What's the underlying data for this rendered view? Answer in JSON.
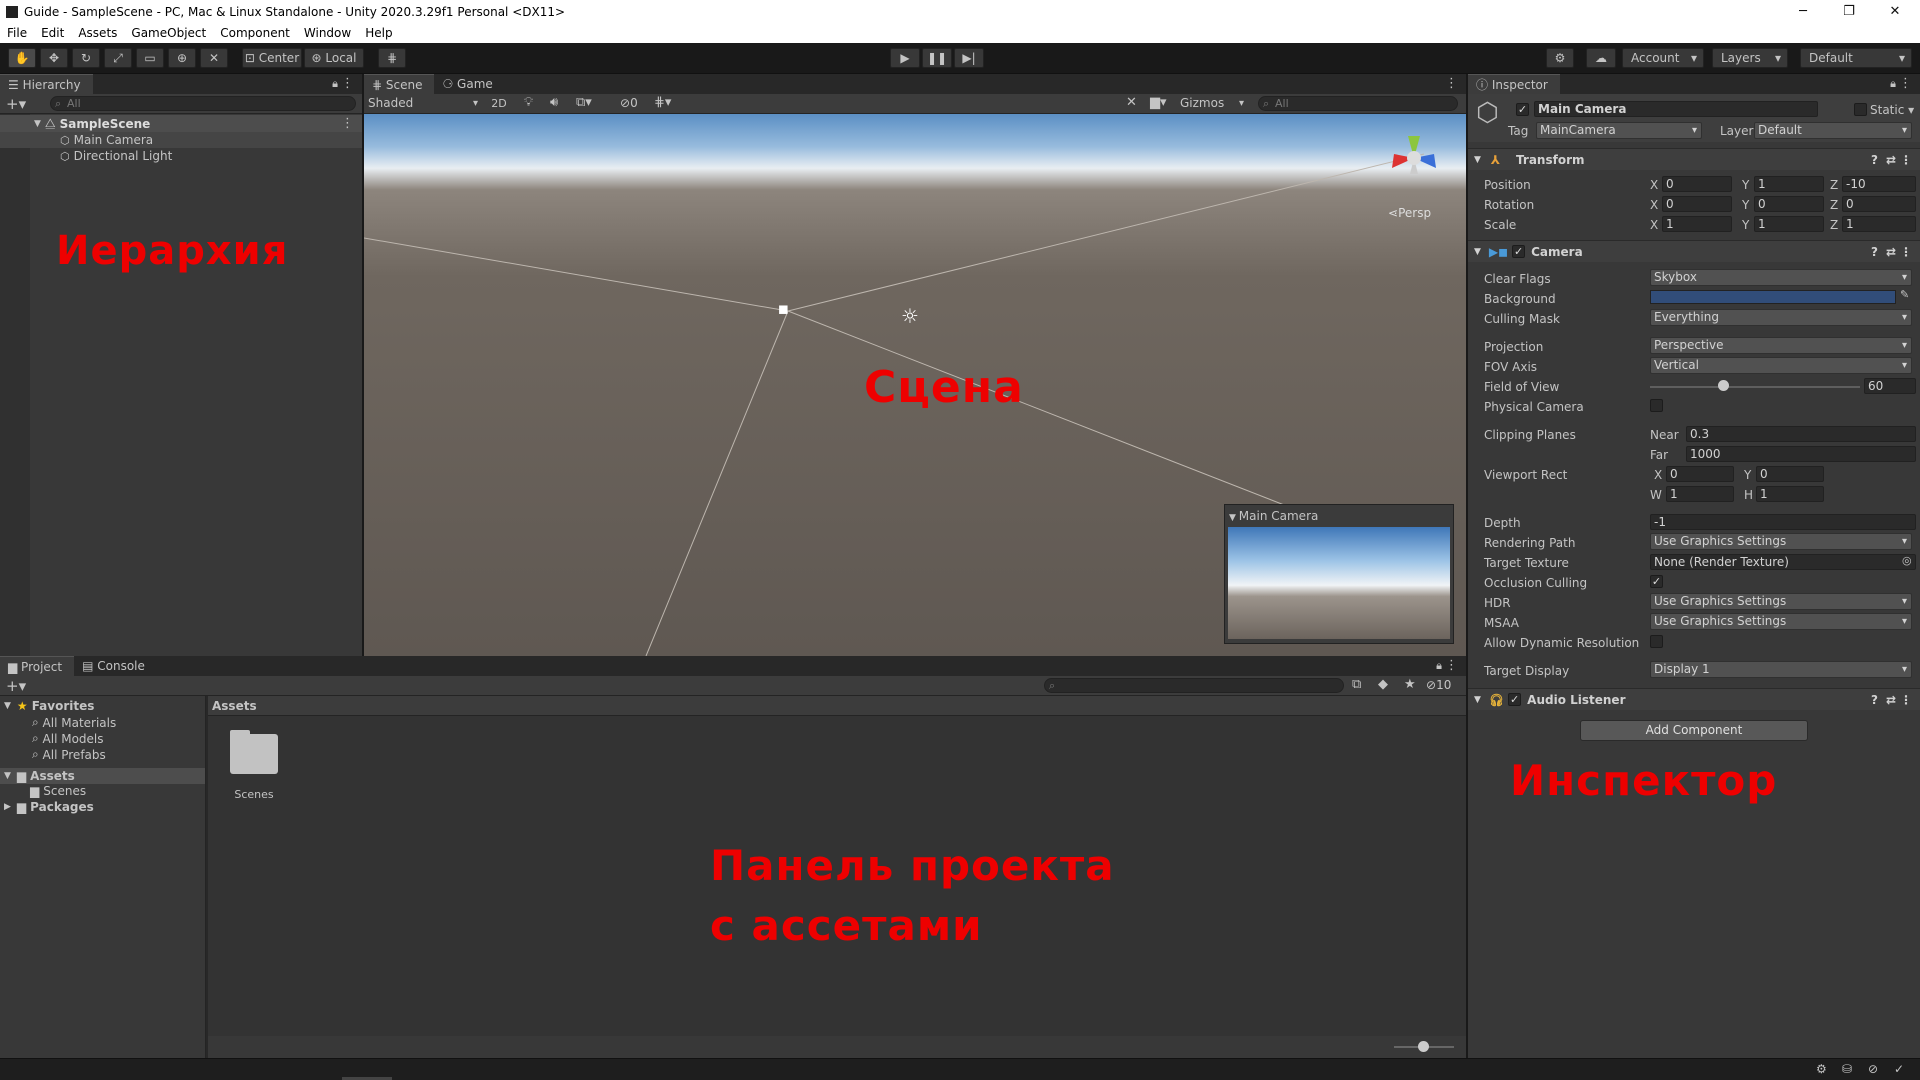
{
  "window": {
    "title": "Guide - SampleScene - PC, Mac & Linux Standalone - Unity 2020.3.29f1 Personal <DX11>",
    "minimize": "─",
    "maximize": "❐",
    "close": "✕"
  },
  "menu": [
    "File",
    "Edit",
    "Assets",
    "GameObject",
    "Component",
    "Window",
    "Help"
  ],
  "toolbar": {
    "center": "Center",
    "local": "Local",
    "account": "Account",
    "layers": "Layers",
    "layout": "Default"
  },
  "hierarchy": {
    "tab": "Hierarchy",
    "search_placeholder": "All",
    "scene": "SampleScene",
    "items": [
      "Main Camera",
      "Directional Light"
    ]
  },
  "scene_view": {
    "tabs": [
      "Scene",
      "Game"
    ],
    "shading": "Shaded",
    "mode_2d": "2D",
    "hidden_count": "0",
    "gizmos": "Gizmos",
    "search_placeholder": "All",
    "persp": "Persp",
    "preview_title": "Main Camera"
  },
  "project": {
    "tabs": [
      "Project",
      "Console"
    ],
    "favorites": "Favorites",
    "favorite_items": [
      "All Materials",
      "All Models",
      "All Prefabs"
    ],
    "tree": {
      "assets": "Assets",
      "scenes": "Scenes",
      "packages": "Packages"
    },
    "breadcrumb": "Assets",
    "files": [
      {
        "name": "Scenes",
        "icon": "folder-icon"
      }
    ],
    "hidden_count": "10"
  },
  "inspector": {
    "tab": "Inspector",
    "object_name": "Main Camera",
    "static": "Static",
    "tag_label": "Tag",
    "tag": "MainCamera",
    "layer_label": "Layer",
    "layer": "Default",
    "transform": {
      "title": "Transform",
      "rows": [
        {
          "label": "Position",
          "x": "0",
          "y": "1",
          "z": "-10"
        },
        {
          "label": "Rotation",
          "x": "0",
          "y": "0",
          "z": "0"
        },
        {
          "label": "Scale",
          "x": "1",
          "y": "1",
          "z": "1"
        }
      ]
    },
    "camera": {
      "title": "Camera",
      "clear_flags_label": "Clear Flags",
      "clear_flags": "Skybox",
      "background_label": "Background",
      "background_color": "#314d79",
      "culling_mask_label": "Culling Mask",
      "culling_mask": "Everything",
      "projection_label": "Projection",
      "projection": "Perspective",
      "fov_axis_label": "FOV Axis",
      "fov_axis": "Vertical",
      "fov_label": "Field of View",
      "fov": "60",
      "physical_label": "Physical Camera",
      "clipping_label": "Clipping Planes",
      "near_label": "Near",
      "near": "0.3",
      "far_label": "Far",
      "far": "1000",
      "viewport_label": "Viewport Rect",
      "vx": "0",
      "vy": "0",
      "vw": "1",
      "vh": "1",
      "depth_label": "Depth",
      "depth": "-1",
      "rendering_path_label": "Rendering Path",
      "rendering_path": "Use Graphics Settings",
      "target_texture_label": "Target Texture",
      "target_texture": "None (Render Texture)",
      "occlusion_label": "Occlusion Culling",
      "hdr_label": "HDR",
      "hdr": "Use Graphics Settings",
      "msaa_label": "MSAA",
      "msaa": "Use Graphics Settings",
      "dynres_label": "Allow Dynamic Resolution",
      "target_display_label": "Target Display",
      "target_display": "Display 1"
    },
    "audio_listener": "Audio Listener",
    "add_component": "Add Component"
  },
  "annotations": {
    "hierarchy": "Иерархия",
    "scene": "Сцена",
    "project_line1": "Панель проекта",
    "project_line2": "с ассетами",
    "inspector": "Инспектор"
  },
  "colors": {
    "annotation": "#ee0000",
    "selection": "#4d4d4d"
  }
}
